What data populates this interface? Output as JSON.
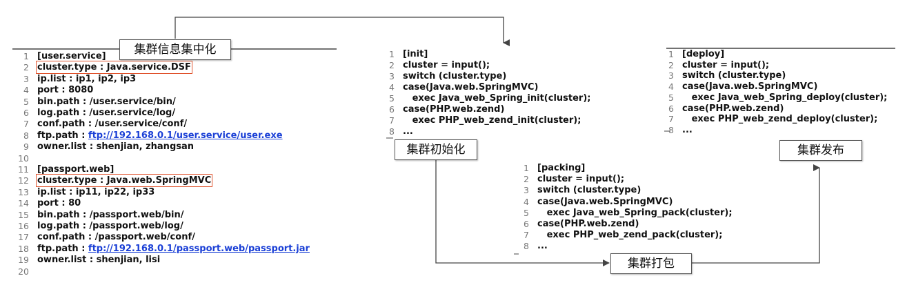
{
  "labels": {
    "centralize": "集群信息集中化",
    "init": "集群初始化",
    "pack": "集群打包",
    "deploy": "集群发布"
  },
  "config": [
    {
      "n": "1",
      "t": "[user.service]"
    },
    {
      "n": "2",
      "t": "cluster.type : Java.service.DSF"
    },
    {
      "n": "3",
      "t": "ip.list : ip1, ip2, ip3"
    },
    {
      "n": "4",
      "t": "port : 8080"
    },
    {
      "n": "5",
      "t": "bin.path : /user.service/bin/"
    },
    {
      "n": "6",
      "t": "log.path : /user.service/log/"
    },
    {
      "n": "7",
      "t": "conf.path : /user.service/conf/"
    },
    {
      "n": "8",
      "t": "ftp.path : ",
      "link": "ftp://192.168.0.1/user.service/user.exe"
    },
    {
      "n": "9",
      "t": "owner.list : shenjian, zhangsan"
    },
    {
      "n": "10",
      "t": ""
    },
    {
      "n": "11",
      "t": "[passport.web]"
    },
    {
      "n": "12",
      "t": "cluster.type : Java.web.SpringMVC"
    },
    {
      "n": "13",
      "t": "ip.list : ip11, ip22, ip33"
    },
    {
      "n": "14",
      "t": "port : 80"
    },
    {
      "n": "15",
      "t": "bin.path : /passport.web/bin/"
    },
    {
      "n": "16",
      "t": "log.path : /passport.web/log/"
    },
    {
      "n": "17",
      "t": "conf.path : /passport.web/conf/"
    },
    {
      "n": "18",
      "t": "ftp.path : ",
      "link": "ftp://192.168.0.1/passport.web/passport.jar"
    },
    {
      "n": "19",
      "t": "owner.list : shenjian, lisi"
    },
    {
      "n": "20",
      "t": ""
    }
  ],
  "init_code": [
    {
      "n": "1",
      "t": "[init]"
    },
    {
      "n": "2",
      "t": "cluster = input();"
    },
    {
      "n": "3",
      "t": "switch (cluster.type)"
    },
    {
      "n": "4",
      "t": "case(Java.web.SpringMVC)"
    },
    {
      "n": "5",
      "t": "   exec Java_web_Spring_init(cluster);"
    },
    {
      "n": "6",
      "t": "case(PHP.web.zend)"
    },
    {
      "n": "7",
      "t": "   exec PHP_web_zend_init(cluster);"
    },
    {
      "n": "8",
      "t": "..."
    }
  ],
  "deploy_code": [
    {
      "n": "1",
      "t": "[deploy]"
    },
    {
      "n": "2",
      "t": "cluster = input();"
    },
    {
      "n": "3",
      "t": "switch (cluster.type)"
    },
    {
      "n": "4",
      "t": "case(Java.web.SpringMVC)"
    },
    {
      "n": "5",
      "t": "   exec Java_web_Spring_deploy(cluster);"
    },
    {
      "n": "6",
      "t": "case(PHP.web.zend)"
    },
    {
      "n": "7",
      "t": "   exec PHP_web_zend_deploy(cluster);"
    },
    {
      "n": "8",
      "t": "..."
    }
  ],
  "pack_code": [
    {
      "n": "1",
      "t": "[packing]"
    },
    {
      "n": "2",
      "t": "cluster = input();"
    },
    {
      "n": "3",
      "t": "switch (cluster.type)"
    },
    {
      "n": "4",
      "t": "case(Java.web.SpringMVC)"
    },
    {
      "n": "5",
      "t": "   exec Java_web_Spring_pack(cluster);"
    },
    {
      "n": "6",
      "t": "case(PHP.web.zend)"
    },
    {
      "n": "7",
      "t": "   exec PHP_web_zend_pack(cluster);"
    },
    {
      "n": "8",
      "t": "..."
    }
  ],
  "colors": {
    "highlight": "#e0542e",
    "link": "#1a3fd6",
    "line": "#444444"
  }
}
